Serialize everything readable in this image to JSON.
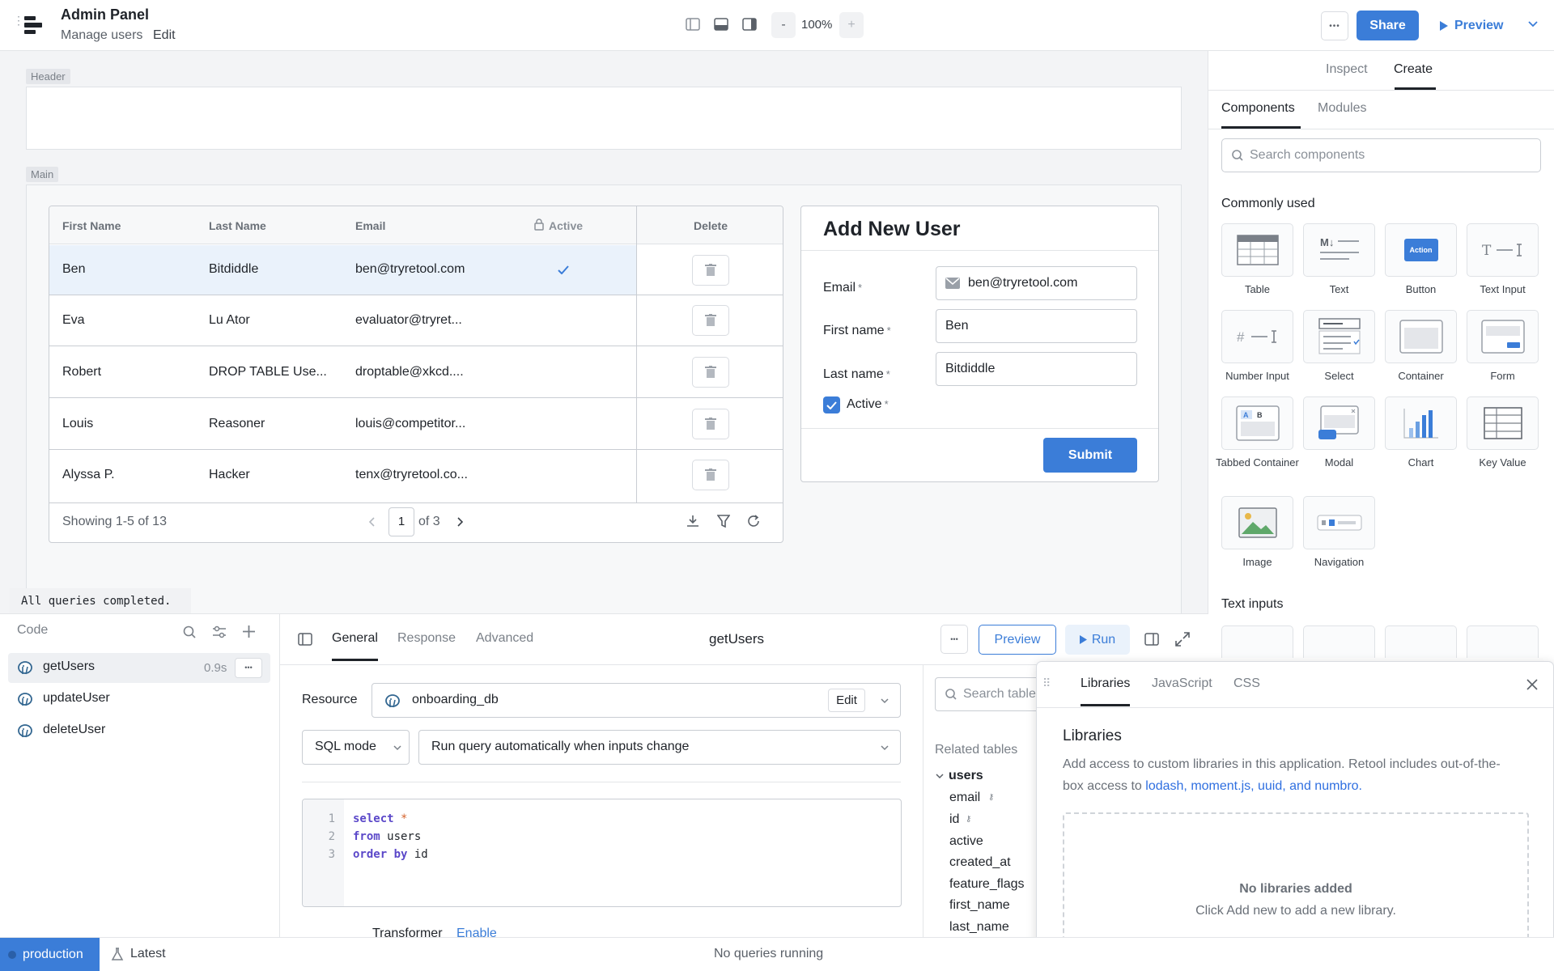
{
  "topbar": {
    "app_title": "Admin Panel",
    "page_name": "Manage users",
    "edit_label": "Edit",
    "zoom_minus": "-",
    "zoom": "100%",
    "zoom_plus": "+",
    "more": "•••",
    "share_label": "Share",
    "preview_label": "Preview"
  },
  "canvas": {
    "header_tag": "Header",
    "main_tag": "Main",
    "query_status": "All queries completed."
  },
  "table": {
    "columns": [
      "First Name",
      "Last Name",
      "Email",
      "Active",
      "Delete"
    ],
    "rows": [
      {
        "first": "Ben",
        "last": "Bitdiddle",
        "email": "ben@tryretool.com",
        "active": true
      },
      {
        "first": "Eva",
        "last": "Lu Ator",
        "email": "evaluator@tryret...",
        "active": false
      },
      {
        "first": "Robert",
        "last": "DROP TABLE Use...",
        "email": "droptable@xkcd....",
        "active": false
      },
      {
        "first": "Louis",
        "last": "Reasoner",
        "email": "louis@competitor...",
        "active": false
      },
      {
        "first": "Alyssa P.",
        "last": "Hacker",
        "email": "tenx@tryretool.co...",
        "active": false
      }
    ],
    "footer": {
      "showing": "Showing 1-5 of 13",
      "page": "1",
      "of_pages": "of 3"
    }
  },
  "form": {
    "title": "Add New User",
    "email_label": "Email",
    "email_value": "ben@tryretool.com",
    "first_label": "First name",
    "first_value": "Ben",
    "last_label": "Last name",
    "last_value": "Bitdiddle",
    "active_label": "Active",
    "required_mark": "*",
    "submit_label": "Submit"
  },
  "right_panel": {
    "tabs": [
      "Inspect",
      "Create"
    ],
    "subtabs": [
      "Components",
      "Modules"
    ],
    "search_placeholder": "Search components",
    "commonly_used_title": "Commonly used",
    "components": [
      "Table",
      "Text",
      "Button",
      "Text Input",
      "Number Input",
      "Select",
      "Container",
      "Form",
      "Tabbed Container",
      "Modal",
      "Chart",
      "Key Value",
      "Image",
      "Navigation"
    ],
    "button_icon_text": "Action",
    "text_inputs_title": "Text inputs"
  },
  "code_panel": {
    "title": "Code",
    "queries": [
      {
        "name": "getUsers",
        "time": "0.9s"
      },
      {
        "name": "updateUser",
        "time": ""
      },
      {
        "name": "deleteUser",
        "time": ""
      }
    ]
  },
  "editor": {
    "tabs": [
      "General",
      "Response",
      "Advanced"
    ],
    "query_name": "getUsers",
    "preview_label": "Preview",
    "run_label": "Run",
    "resource_label": "Resource",
    "resource_value": "onboarding_db",
    "resource_edit": "Edit",
    "mode_value": "SQL mode",
    "trigger_value": "Run query automatically when inputs change",
    "code_lines": [
      {
        "num": "1",
        "kw": "select",
        "rest": " *"
      },
      {
        "num": "2",
        "kw": "from",
        "rest": " users"
      },
      {
        "num": "3",
        "kw": "order by",
        "rest": " id"
      }
    ],
    "transformer_label": "Transformer",
    "transformer_enable": "Enable",
    "search_tables_placeholder": "Search table",
    "related_tables": "Related tables",
    "table_name": "users",
    "fields": [
      "email",
      "id",
      "active",
      "created_at",
      "feature_flags",
      "first_name",
      "last_name"
    ]
  },
  "libraries": {
    "tabs": [
      "Libraries",
      "JavaScript",
      "CSS"
    ],
    "title": "Libraries",
    "desc_pre": "Add access to custom libraries in this application. Retool includes out-of-the-box access to ",
    "desc_links": "lodash, moment.js, uuid, and numbro.",
    "empty_title": "No libraries added",
    "empty_sub": "Click Add new to add a new library."
  },
  "statusbar": {
    "env": "production",
    "version": "Latest",
    "running": "No queries running"
  },
  "colors": {
    "accent": "#3b7dd8",
    "selected_row": "#eaf2fb",
    "env_badge": "#3b7dd8"
  }
}
